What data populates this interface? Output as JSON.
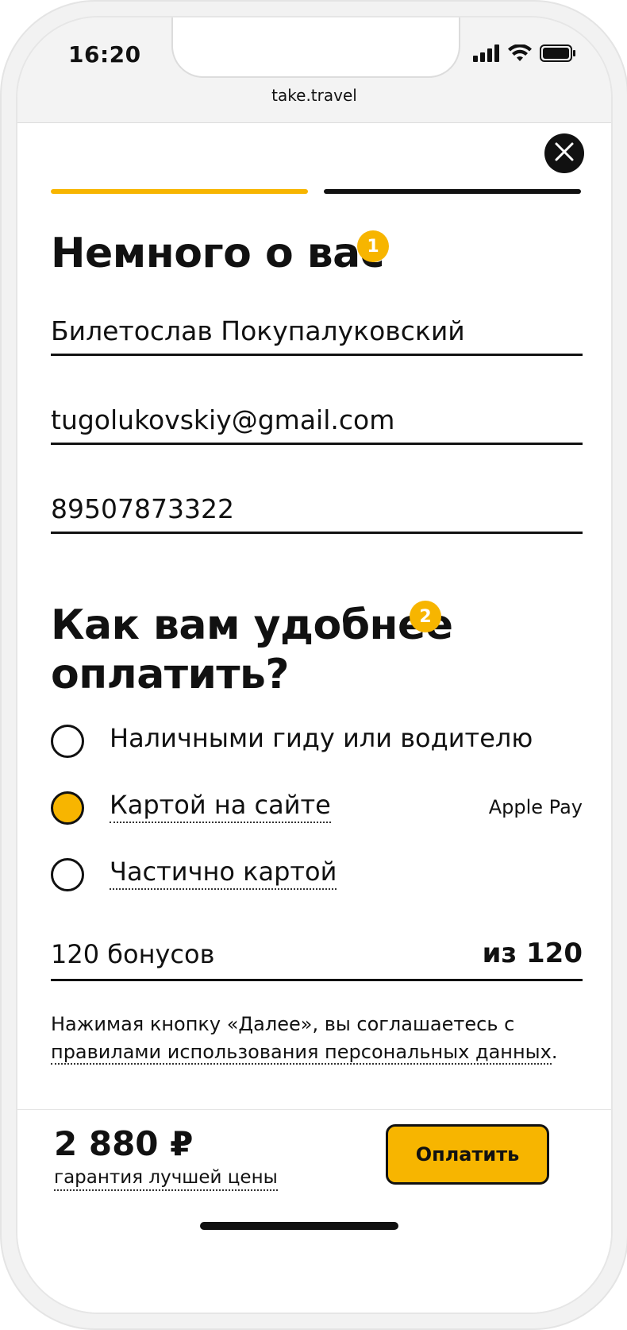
{
  "status_bar": {
    "time": "16:20",
    "signal_icon": "signal-bars-icon",
    "wifi_icon": "wifi-icon",
    "battery_icon": "battery-icon",
    "domain": "take.travel"
  },
  "progress": {
    "steps_total": 2,
    "current_step": 1,
    "colors": {
      "active": "#f7b500",
      "inactive": "#111111"
    }
  },
  "about": {
    "title": "Немного о вас",
    "badge": "1",
    "name_value": "Билетослав Покупалуковский",
    "email_value": "tugolukovskiy@gmail.com",
    "phone_value": "89507873322"
  },
  "payment": {
    "title_line1": "Как вам удобнее",
    "title_line2": "оплатить?",
    "badge": "2",
    "options": [
      {
        "label": "Наличными гиду или водителю",
        "selected": false,
        "extra": ""
      },
      {
        "label": "Картой на сайте",
        "selected": true,
        "extra": "Apple Pay"
      },
      {
        "label": "Частично картой",
        "selected": false,
        "extra": ""
      }
    ]
  },
  "bonus": {
    "value": "120 бонусов",
    "max": "из 120"
  },
  "terms": {
    "prefix": "Нажимая кнопку «Далее», вы соглашаетесь с ",
    "link": "правилами использования персональных данных",
    "suffix": "."
  },
  "footer": {
    "price": "2 880 ₽",
    "guarantee": "гарантия лучшей цены",
    "pay_button": "Оплатить"
  },
  "colors": {
    "accent": "#f7b500",
    "text": "#111111"
  }
}
